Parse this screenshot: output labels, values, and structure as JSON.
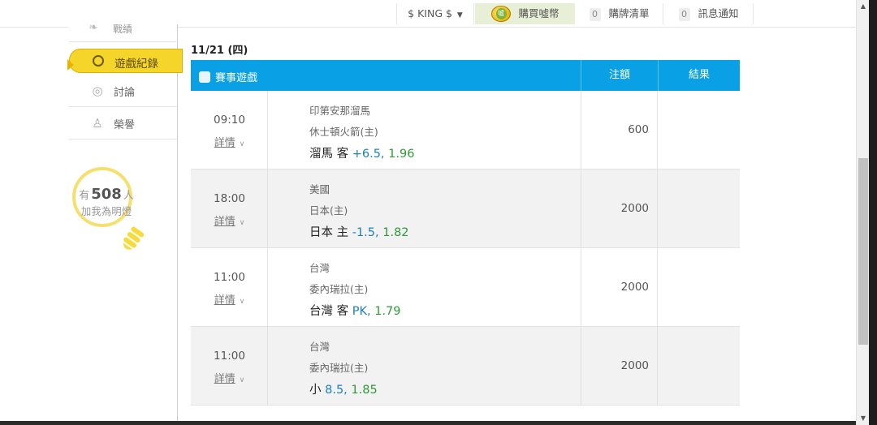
{
  "topbar": {
    "user": "$ KING $",
    "buy_coins": "購買噓幣",
    "cart": {
      "count": "0",
      "label": "購牌清單"
    },
    "messages": {
      "count": "0",
      "label": "訊息通知"
    }
  },
  "sidebar": {
    "prev_label": "戰績",
    "active_label": "遊戲紀錄",
    "items": [
      {
        "label": "討論",
        "icon": "chat-icon"
      },
      {
        "label": "榮譽",
        "icon": "medal-icon"
      }
    ],
    "fans": {
      "prefix": "有",
      "count": "508",
      "suffix": "人",
      "line2": "加我為明燈"
    }
  },
  "main": {
    "date": "11/21 (四)",
    "headers": {
      "game": "賽事遊戲",
      "stake": "注額",
      "result": "結果"
    },
    "rows": [
      {
        "time": "09:10",
        "detail": "詳情",
        "away": "印第安那溜馬",
        "home": "休士頓火箭(主)",
        "pick_team": "溜馬 客",
        "pick_line": "+6.5,",
        "pick_odds": "1.96",
        "stake": "600"
      },
      {
        "time": "18:00",
        "detail": "詳情",
        "away": "美國",
        "home": "日本(主)",
        "pick_team": "日本 主",
        "pick_line": "-1.5,",
        "pick_odds": "1.82",
        "stake": "2000"
      },
      {
        "time": "11:00",
        "detail": "詳情",
        "away": "台灣",
        "home": "委內瑞拉(主)",
        "pick_team": "台灣 客",
        "pick_line": "PK,",
        "pick_odds": "1.79",
        "stake": "2000"
      },
      {
        "time": "11:00",
        "detail": "詳情",
        "away": "台灣",
        "home": "委內瑞拉(主)",
        "pick_team": "小",
        "pick_line": "8.5,",
        "pick_odds": "1.85",
        "stake": "2000"
      }
    ]
  }
}
